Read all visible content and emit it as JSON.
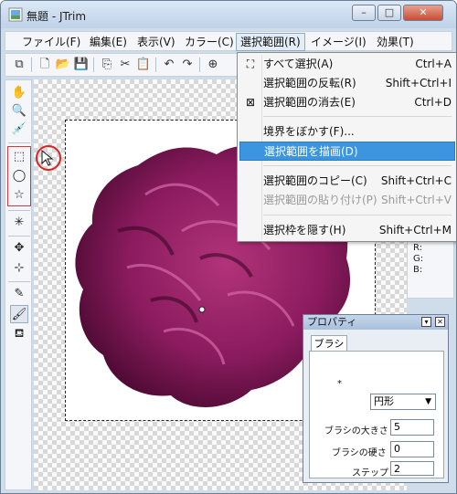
{
  "window": {
    "title": "無題 - JTrim",
    "minimize_label": "–",
    "maximize_label": "□",
    "close_label": "✕"
  },
  "menubar": [
    "ファイル(F)",
    "編集(E)",
    "表示(V)",
    "カラー(C)",
    "選択範囲(R)",
    "イメージ(I)",
    "効果(T)"
  ],
  "active_menu": "選択範囲(R)",
  "dropdown": {
    "items": [
      {
        "icon": "select-all-icon",
        "glyph": "⛶",
        "label": "すべて選択(A)",
        "shortcut": "Ctrl+A"
      },
      {
        "icon": "",
        "glyph": "",
        "label": "選択範囲の反転(R)",
        "shortcut": "Shift+Ctrl+I"
      },
      {
        "icon": "deselect-icon",
        "glyph": "⊠",
        "label": "選択範囲の消去(E)",
        "shortcut": "Ctrl+D"
      },
      {
        "icon": "",
        "glyph": "",
        "label": "境界をぼかす(F)...",
        "shortcut": ""
      },
      {
        "icon": "",
        "glyph": "",
        "label": "選択範囲を描画(D)",
        "shortcut": ""
      },
      {
        "icon": "",
        "glyph": "",
        "label": "選択範囲のコピー(C)",
        "shortcut": "Shift+Ctrl+C"
      },
      {
        "icon": "",
        "glyph": "",
        "label": "選択範囲の貼り付け(P)",
        "shortcut": "Shift+Ctrl+V"
      },
      {
        "icon": "",
        "glyph": "",
        "label": "選択枠を隠す(H)",
        "shortcut": "Shift+Ctrl+M"
      }
    ],
    "highlighted": "選択範囲を描画(D)",
    "disabled": "選択範囲の貼り付け(P)"
  },
  "color_readout": {
    "r": "R:",
    "g": "G:",
    "b": "B:"
  },
  "properties": {
    "title": "プロパティ",
    "tab": "ブラシ",
    "dot": "*",
    "shape_select": "円形",
    "size_label": "ブラシの大きさ",
    "size_value": "5",
    "hardness_label": "ブラシの硬さ",
    "hardness_value": "0",
    "step_label": "ステップ",
    "step_value": "2"
  },
  "colors": {
    "highlight": "#3d95e0",
    "annotation_red": "#d22222",
    "flower": "#8a1b5e"
  }
}
